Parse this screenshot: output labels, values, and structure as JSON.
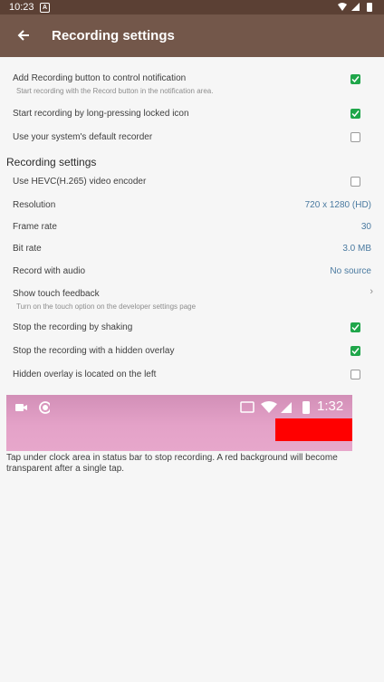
{
  "status_bar": {
    "time": "10:23",
    "notification_letter": "A"
  },
  "app_bar": {
    "title": "Recording settings"
  },
  "general": [
    {
      "label": "Add Recording button to control notification",
      "sub": "Start recording with the Record button in the notification area.",
      "checked": true
    },
    {
      "label": "Start recording by long-pressing locked icon",
      "checked": true
    },
    {
      "label": "Use your system's default recorder",
      "checked": false
    }
  ],
  "section_title": "Recording settings",
  "settings": {
    "hevc": {
      "label": "Use HEVC(H.265) video encoder",
      "checked": false
    },
    "resolution": {
      "label": "Resolution",
      "value": "720 x 1280 (HD)"
    },
    "frame_rate": {
      "label": "Frame rate",
      "value": "30"
    },
    "bit_rate": {
      "label": "Bit rate",
      "value": "3.0 MB"
    },
    "audio": {
      "label": "Record with audio",
      "value": "No source"
    },
    "touch": {
      "label": "Show touch feedback",
      "sub": "Turn on the touch option on the developer settings page"
    },
    "shake": {
      "label": "Stop the recording by shaking",
      "checked": true
    },
    "overlay": {
      "label": "Stop the recording with a hidden overlay",
      "checked": true
    },
    "overlay_left": {
      "label": "Hidden overlay is located on the left",
      "checked": false
    }
  },
  "preview": {
    "time": "1:32"
  },
  "caption": "Tap under clock area in status bar to stop recording. A red background will become transparent after a single tap.",
  "colors": {
    "status_bar": "#5b4034",
    "app_bar": "#73574a",
    "checkbox_on": "#1fa64a",
    "value_text": "#4a7aa0",
    "overlay_red": "#ff0000"
  }
}
